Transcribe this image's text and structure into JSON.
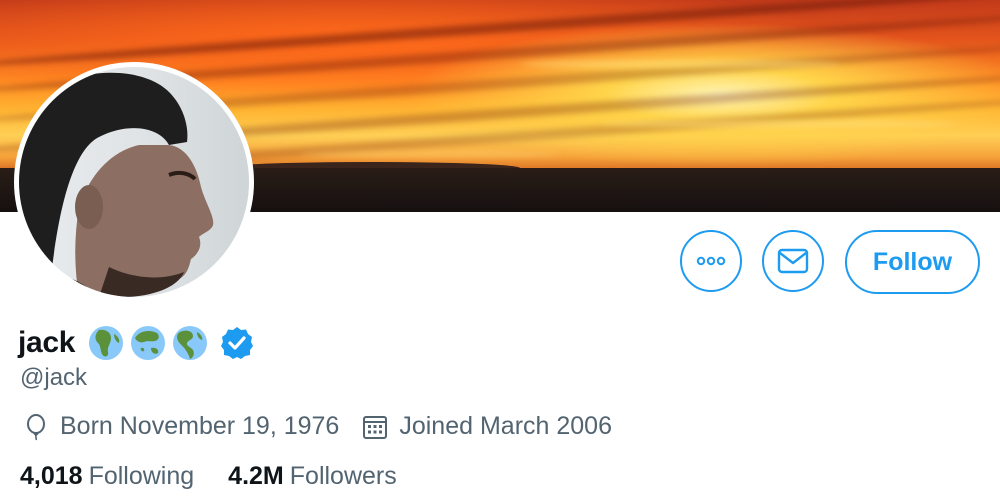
{
  "profile": {
    "name": "jack",
    "handle": "@jack",
    "name_emojis": [
      "earth-africa-icon",
      "earth-asia-icon",
      "earth-americas-icon"
    ],
    "verified": true,
    "born": "Born November 19, 1976",
    "joined": "Joined March 2006"
  },
  "stats": {
    "following_count": "4,018",
    "following_label": "Following",
    "followers_count": "4.2M",
    "followers_label": "Followers"
  },
  "actions": {
    "follow_label": "Follow",
    "more_icon": "more-icon",
    "message_icon": "envelope-icon"
  },
  "colors": {
    "accent": "#1d9bf0",
    "secondary_text": "#536471",
    "primary_text": "#0f1419"
  }
}
